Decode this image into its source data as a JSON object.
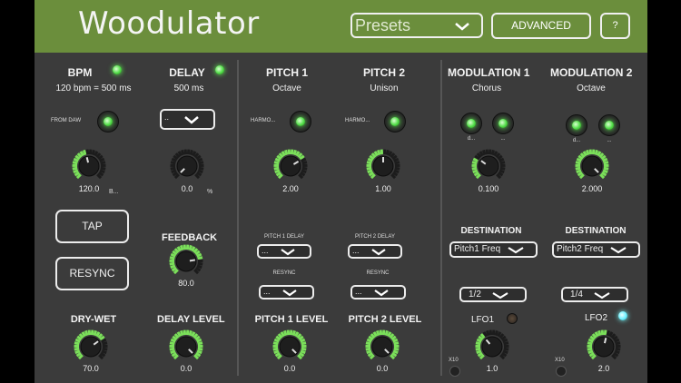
{
  "app_title": "Woodulator",
  "header": {
    "presets": "Presets",
    "advanced": "ADVANCED",
    "help": "?"
  },
  "bpm": {
    "title": "BPM",
    "subtitle": "120 bpm = 500 ms",
    "from_daw": "FROM DAW",
    "value": "120.0",
    "unit": "B...",
    "tap": "TAP",
    "resync": "RESYNC",
    "drywet_title": "DRY-WET",
    "drywet_value": "70.0"
  },
  "delay": {
    "title": "DELAY",
    "subtitle": "500 ms",
    "dropdown": "..",
    "value": "0.0",
    "unit": "%",
    "feedback_title": "FEEDBACK",
    "feedback_value": "80.0",
    "level_title": "DELAY LEVEL",
    "level_value": "0.0"
  },
  "pitch1": {
    "title": "PITCH 1",
    "subtitle": "Octave",
    "harmo": "HARMO...",
    "value": "2.00",
    "delay_label": "PITCH 1 DELAY",
    "delay_value": "...",
    "resync_label": "RESYNC",
    "resync_value": "...",
    "level_title": "PITCH 1 LEVEL",
    "level_value": "0.0"
  },
  "pitch2": {
    "title": "PITCH 2",
    "subtitle": "Unison",
    "harmo": "HARMO...",
    "value": "1.00",
    "delay_label": "PITCH 2 DELAY",
    "delay_value": "...",
    "resync_label": "RESYNC",
    "resync_value": "...",
    "level_title": "PITCH 2 LEVEL",
    "level_value": "0.0"
  },
  "mod1": {
    "title": "MODULATION 1",
    "subtitle": "Chorus",
    "sw1": "d...",
    "sw2": "...",
    "value": "0.100",
    "dest_title": "DESTINATION",
    "dest_value": "Pitch1 Freq",
    "rate": "1/2",
    "lfo": "LFO1",
    "x10": "X10",
    "lfo_value": "1.0"
  },
  "mod2": {
    "title": "MODULATION 2",
    "subtitle": "Octave",
    "sw1": "d...",
    "sw2": "...",
    "value": "2.000",
    "dest_title": "DESTINATION",
    "dest_value": "Pitch2 Freq",
    "rate": "1/4",
    "lfo": "LFO2",
    "x10": "X10",
    "lfo_value": "2.0"
  },
  "colors": {
    "header": "#6b8e3c",
    "panel": "#3b3b3b",
    "knob_active": "#7be05a",
    "led_green": "#4fdc45",
    "led_cyan": "#6bf0ff"
  },
  "knob_levels": {
    "bpm": 0.45,
    "delay": 0.0,
    "feedback": 0.8,
    "drywet": 0.7,
    "delaylevel": 1.0,
    "pitch1": 0.72,
    "pitch2": 0.5,
    "pitch1level": 1.0,
    "pitch2level": 1.0,
    "mod1": 0.3,
    "mod2": 1.0,
    "lfo1": 0.35,
    "lfo2": 0.55
  }
}
